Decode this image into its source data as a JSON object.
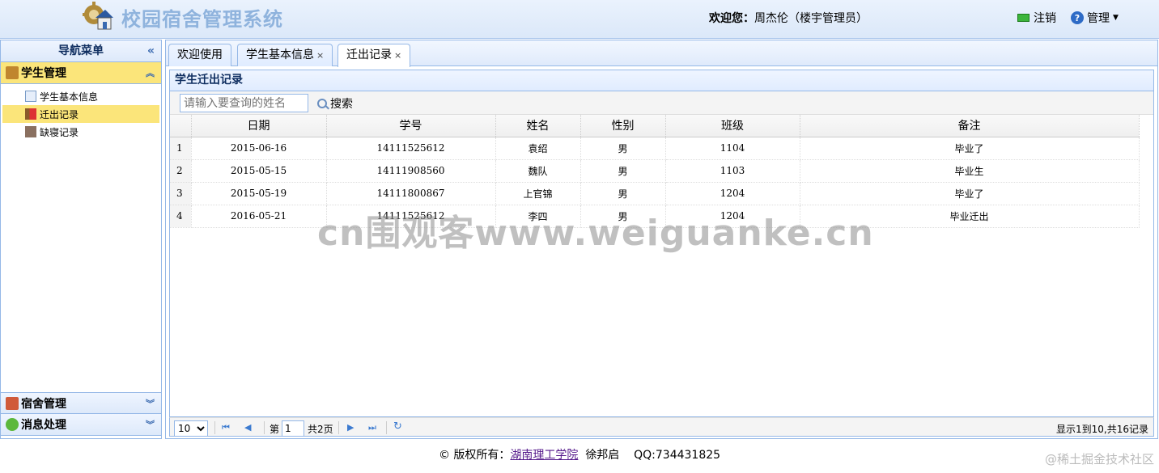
{
  "header": {
    "app_title": "校园宿舍管理系统",
    "welcome_label": "欢迎您：",
    "welcome_user": "周杰伦（楼宇管理员）",
    "logout_label": "注销",
    "manage_label": "管理"
  },
  "sidebar": {
    "title": "导航菜单",
    "sections": [
      {
        "label": "学生管理",
        "icon": "student-icon",
        "items": [
          {
            "label": "学生基本信息",
            "icon": "info-icon"
          },
          {
            "label": "迁出记录",
            "icon": "moveout-icon",
            "selected": true
          },
          {
            "label": "缺寝记录",
            "icon": "absence-icon"
          }
        ]
      },
      {
        "label": "宿舍管理",
        "icon": "dorm-icon"
      },
      {
        "label": "消息处理",
        "icon": "message-icon"
      }
    ]
  },
  "tabs": [
    {
      "label": "欢迎使用",
      "closable": false
    },
    {
      "label": "学生基本信息",
      "closable": true
    },
    {
      "label": "迁出记录",
      "closable": true,
      "active": true
    }
  ],
  "panel": {
    "title": "学生迁出记录",
    "search_placeholder": "请输入要查询的姓名",
    "search_button": "搜索"
  },
  "table": {
    "columns": [
      "日期",
      "学号",
      "姓名",
      "性别",
      "班级",
      "备注"
    ],
    "rows": [
      {
        "n": "1",
        "date": "2015-06-16",
        "id": "14111525612",
        "name": "袁绍",
        "sex": "男",
        "cls": "1104",
        "note": "毕业了"
      },
      {
        "n": "2",
        "date": "2015-05-15",
        "id": "14111908560",
        "name": "魏队",
        "sex": "男",
        "cls": "1103",
        "note": "毕业生"
      },
      {
        "n": "3",
        "date": "2015-05-19",
        "id": "14111800867",
        "name": "上官锦",
        "sex": "男",
        "cls": "1204",
        "note": "毕业了"
      },
      {
        "n": "4",
        "date": "2016-05-21",
        "id": "14111525612",
        "name": "李四",
        "sex": "男",
        "cls": "1204",
        "note": "毕业迁出"
      }
    ]
  },
  "pager": {
    "page_size": "10",
    "page_prefix": "第",
    "page_value": "1",
    "page_total": "共2页",
    "summary": "显示1到10,共16记录"
  },
  "footer": {
    "copyright": "© 版权所有：",
    "school": "湖南理工学院",
    "author": "徐邦启",
    "qq": "QQ:734431825"
  },
  "overlay": {
    "watermark": "cn围观客www.weiguanke.cn",
    "juejin": "@稀土掘金技术社区"
  },
  "colors": {
    "accent": "#95b8e7",
    "selected": "#fbe57a",
    "title": "#8fb3dd"
  }
}
